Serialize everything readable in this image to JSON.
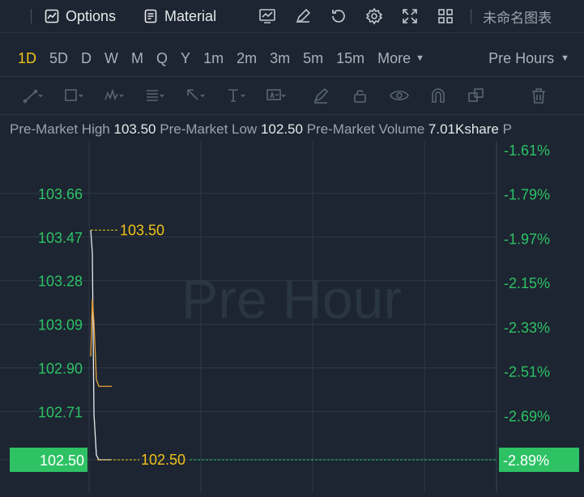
{
  "toolbar": {
    "options_label": "Options",
    "material_label": "Material",
    "chart_name": "未命名图表"
  },
  "periods": {
    "items": [
      "1D",
      "5D",
      "D",
      "W",
      "M",
      "Q",
      "Y",
      "1m",
      "2m",
      "3m",
      "5m",
      "15m"
    ],
    "active": "1D",
    "more_label": "More",
    "session_label": "Pre Hours"
  },
  "info": {
    "high_label": "Pre-Market High",
    "high_value": "103.50",
    "low_label": "Pre-Market Low",
    "low_value": "102.50",
    "volume_label": "Pre-Market Volume",
    "volume_value": "7.01Kshare",
    "trailing": "P"
  },
  "colors": {
    "background": "#1c2531",
    "price_line": "#e8ecf0",
    "avg_line": "#e8a23a",
    "axis_text": "#2ec265",
    "marker_text": "#f2c21b",
    "current_bg": "#2ec265",
    "active_period": "#f2c21b"
  },
  "chart_data": {
    "type": "line",
    "watermark": "Pre Hour",
    "yticks": [
      "103.66",
      "103.47",
      "103.28",
      "103.09",
      "102.90",
      "102.71",
      "102.50"
    ],
    "yticks_pct": [
      "-1.61%",
      "-1.79%",
      "-1.97%",
      "-2.15%",
      "-2.33%",
      "-2.51%",
      "-2.69%",
      "-2.89%"
    ],
    "ylim": [
      102.5,
      103.85
    ],
    "high_marker": "103.50",
    "low_marker": "102.50",
    "current_price": "102.50",
    "current_pct": "-2.89%",
    "series": [
      {
        "values": [
          103.5,
          103.4,
          102.7,
          102.52,
          102.5,
          102.5,
          102.5
        ]
      },
      {
        "values": [
          102.95,
          103.2,
          103.1,
          102.85,
          102.82,
          102.82,
          102.82
        ]
      }
    ]
  }
}
